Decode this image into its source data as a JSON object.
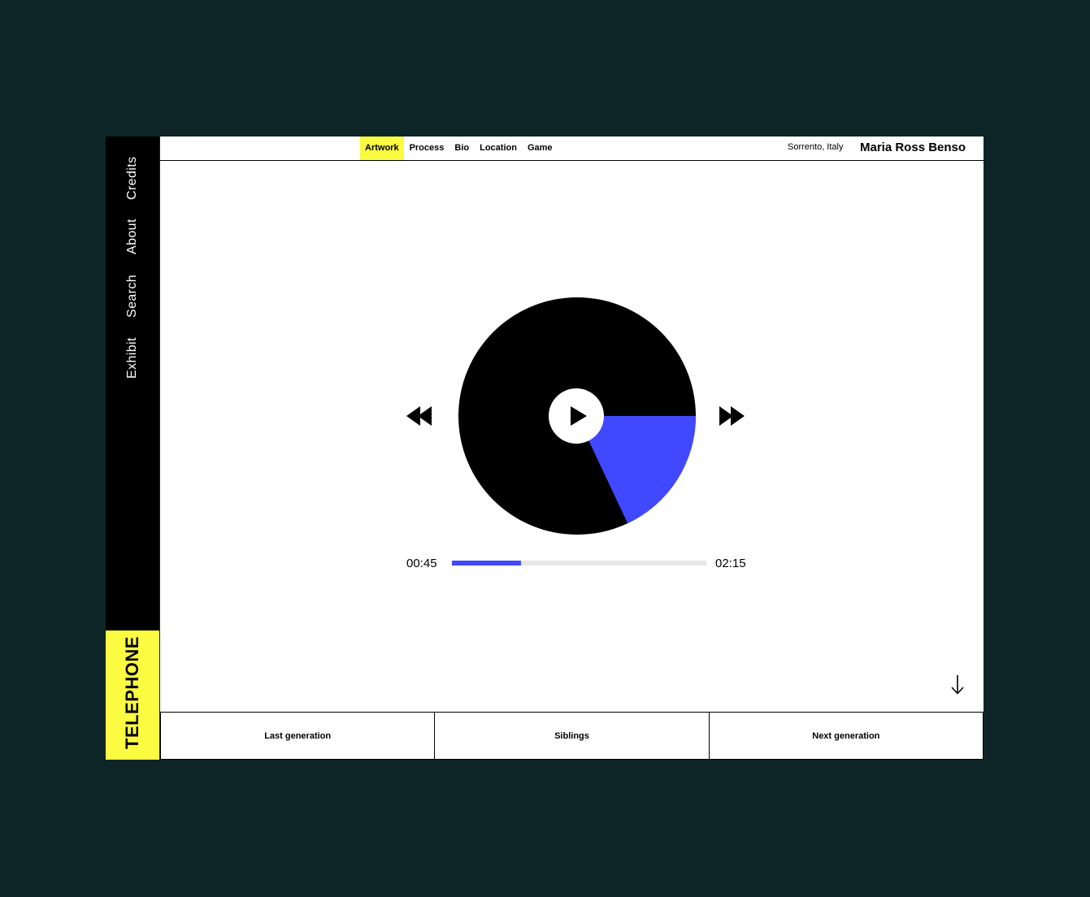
{
  "sidebar": {
    "links": [
      "Credits",
      "About",
      "Search",
      "Exhibit"
    ],
    "brand": "TELEPHONE"
  },
  "topbar": {
    "tabs": [
      "Artwork",
      "Process",
      "Bio",
      "Location",
      "Game"
    ],
    "active_tab": "Artwork",
    "location": "Sorrento, Italy",
    "artist": "Maria Ross Benso"
  },
  "player": {
    "current_time": "00:45",
    "total_time": "02:15",
    "progress_fraction": 0.27,
    "disc_highlight_fraction": 0.18,
    "play_icon": "play-icon",
    "rewind_icon": "rewind-icon",
    "fast_forward_icon": "fast-forward-icon"
  },
  "scroll_icon": "arrow-down-icon",
  "bottom_nav": [
    "Last generation",
    "Siblings",
    "Next generation"
  ],
  "colors": {
    "background": "#0d2526",
    "accent_yellow": "#fbfb42",
    "accent_blue": "#4049ff",
    "track": "#e6e6e6"
  }
}
